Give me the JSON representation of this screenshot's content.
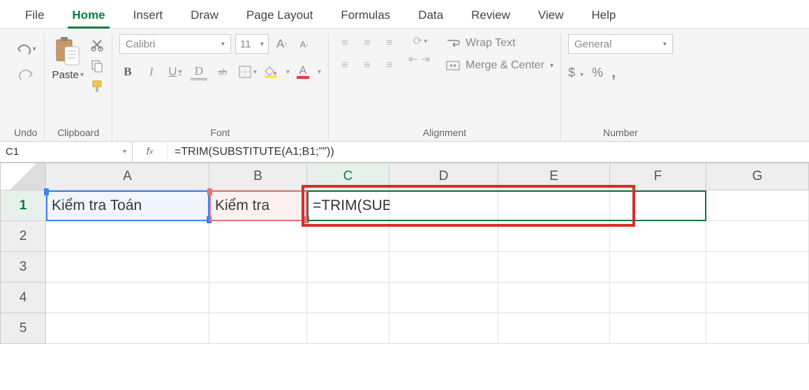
{
  "tabs": {
    "file": "File",
    "home": "Home",
    "insert": "Insert",
    "draw": "Draw",
    "page_layout": "Page Layout",
    "formulas": "Formulas",
    "data": "Data",
    "review": "Review",
    "view": "View",
    "help": "Help"
  },
  "ribbon": {
    "undo_label": "Undo",
    "clipboard": {
      "paste": "Paste",
      "label": "Clipboard"
    },
    "font": {
      "name": "Calibri",
      "size": "11",
      "bold": "B",
      "italic": "I",
      "underline": "U",
      "double_u": "D",
      "strike": "ab",
      "label": "Font",
      "grow": "A",
      "shrink": "A"
    },
    "alignment": {
      "wrap": "Wrap Text",
      "merge": "Merge & Center",
      "label": "Alignment"
    },
    "number": {
      "format": "General",
      "currency": "$",
      "percent": "%",
      "comma": ",",
      "label": "Number"
    }
  },
  "namebox": "C1",
  "formula_bar": "=TRIM(SUBSTITUTE(A1;B1;\"\"))",
  "columns": [
    "A",
    "B",
    "C",
    "D",
    "E",
    "F",
    "G"
  ],
  "rows": [
    "1",
    "2",
    "3",
    "4",
    "5"
  ],
  "cells": {
    "A1": "Kiểm tra Toán",
    "B1": "Kiểm tra",
    "C1_formula_prefix": "=TRIM(SUBSTITUTE(",
    "C1_ref1": "A1",
    "C1_sep1": ";",
    "C1_ref2": "B1",
    "C1_suffix": ";\"\"))"
  },
  "chart_data": null
}
